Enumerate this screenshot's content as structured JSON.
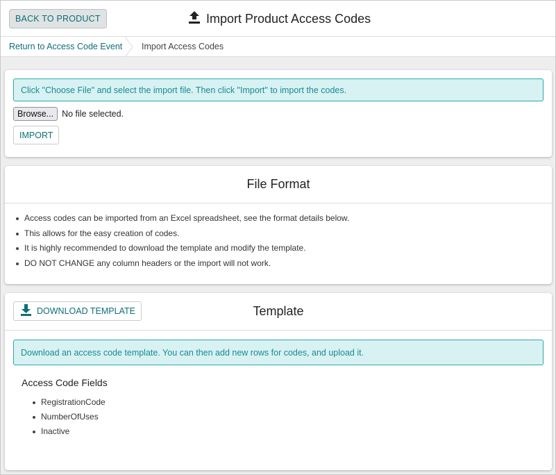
{
  "header": {
    "back_label": "BACK TO PRODUCT",
    "title": "Import Product Access Codes",
    "title_icon": "upload-icon"
  },
  "breadcrumb": {
    "items": [
      {
        "label": "Return to Access Code Event"
      },
      {
        "label": "Import Access Codes"
      }
    ]
  },
  "import_card": {
    "alert": "Click \"Choose File\" and select the import file. Then click \"Import\" to import the codes.",
    "browse_label": "Browse...",
    "file_status": "No file selected.",
    "import_label": "IMPORT"
  },
  "format_card": {
    "title": "File Format",
    "bullets": [
      "Access codes can be imported from an Excel spreadsheet, see the format details below.",
      "This allows for the easy creation of codes.",
      "It is highly recommended to download the template and modify the template.",
      "DO NOT CHANGE any column headers or the import will not work."
    ]
  },
  "template_card": {
    "download_label": "DOWNLOAD TEMPLATE",
    "download_icon": "download-icon",
    "title": "Template",
    "alert": "Download an access code template. You can then add new rows for codes, and upload it.",
    "fields_title": "Access Code Fields",
    "fields": [
      "RegistrationCode",
      "NumberOfUses",
      "Inactive"
    ]
  },
  "colors": {
    "accent": "#0d6e78",
    "alert_bg": "#d8f1f2",
    "alert_border": "#2aa7ad",
    "alert_text": "#178c93"
  }
}
